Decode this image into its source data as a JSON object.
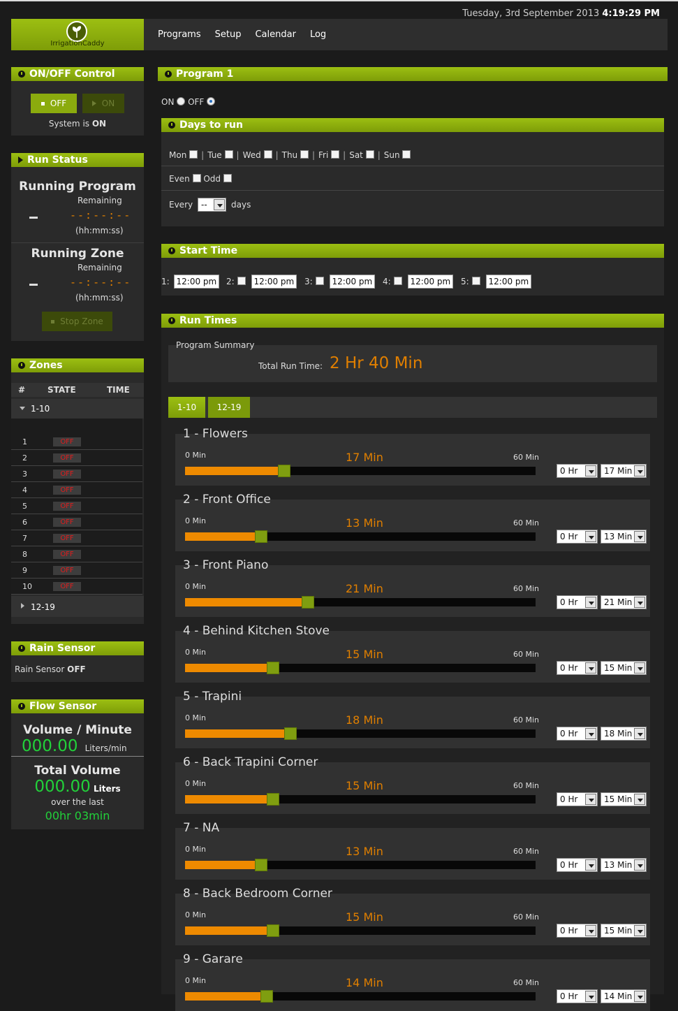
{
  "datetime": {
    "date": "Tuesday, 3rd September 2013",
    "time": "4:19:29 PM"
  },
  "logo": {
    "text": "IrrigationCaddy"
  },
  "nav": [
    "Programs",
    "Setup",
    "Calendar",
    "Log"
  ],
  "onoff": {
    "title": "ON/OFF Control",
    "off_label": "OFF",
    "on_label": "ON",
    "status_prefix": "System is",
    "status_value": "ON"
  },
  "run_status": {
    "title": "Run Status",
    "program_title": "Running Program",
    "zone_title": "Running Zone",
    "remaining": "Remaining",
    "time": "--:--:--",
    "unit": "(hh:mm:ss)",
    "stop_label": "Stop Zone"
  },
  "zones_panel": {
    "title": "Zones",
    "col_num": "#",
    "col_state": "STATE",
    "col_time": "TIME",
    "group1": "1-10",
    "group2": "12-19",
    "rows": [
      {
        "num": "1",
        "state": "OFF"
      },
      {
        "num": "2",
        "state": "OFF"
      },
      {
        "num": "3",
        "state": "OFF"
      },
      {
        "num": "4",
        "state": "OFF"
      },
      {
        "num": "5",
        "state": "OFF"
      },
      {
        "num": "6",
        "state": "OFF"
      },
      {
        "num": "7",
        "state": "OFF"
      },
      {
        "num": "8",
        "state": "OFF"
      },
      {
        "num": "9",
        "state": "OFF"
      },
      {
        "num": "10",
        "state": "OFF"
      }
    ]
  },
  "rain": {
    "title": "Rain Sensor",
    "label": "Rain Sensor",
    "value": "OFF"
  },
  "flow": {
    "title": "Flow Sensor",
    "vpm_title": "Volume / Minute",
    "vpm_value": "000.00",
    "vpm_unit": "Liters/min",
    "total_title": "Total Volume",
    "total_value": "000.00",
    "total_unit": "Liters",
    "over_last": "over the last",
    "duration": "00hr 03min"
  },
  "program": {
    "title": "Program 1",
    "on_label": "ON",
    "off_label": "OFF",
    "days_title": "Days to run",
    "days": [
      "Mon",
      "Tue",
      "Wed",
      "Thu",
      "Fri",
      "Sat",
      "Sun"
    ],
    "even": "Even",
    "odd": "Odd",
    "every": "Every",
    "every_value": "--",
    "days_suffix": "days",
    "start_title": "Start Time",
    "starts": [
      {
        "label": "1:",
        "value": "12:00 pm"
      },
      {
        "label": "2:",
        "value": "12:00 pm"
      },
      {
        "label": "3:",
        "value": "12:00 pm"
      },
      {
        "label": "4:",
        "value": "12:00 pm"
      },
      {
        "label": "5:",
        "value": "12:00 pm"
      }
    ],
    "run_title": "Run Times",
    "summary_title": "Program Summary",
    "total_label": "Total Run Time:",
    "total_value": "2 Hr 40 Min",
    "tabs": [
      "1-10",
      "12-19"
    ],
    "min_label": "0 Min",
    "max_label": "60 Min",
    "zones": [
      {
        "name": "1 - Flowers",
        "minutes": 17,
        "value": "17 Min",
        "hr": "0 Hr",
        "min_sel": "17 Min"
      },
      {
        "name": "2 - Front Office",
        "minutes": 13,
        "value": "13 Min",
        "hr": "0 Hr",
        "min_sel": "13 Min"
      },
      {
        "name": "3 - Front Piano",
        "minutes": 21,
        "value": "21 Min",
        "hr": "0 Hr",
        "min_sel": "21 Min"
      },
      {
        "name": "4 - Behind Kitchen Stove",
        "minutes": 15,
        "value": "15 Min",
        "hr": "0 Hr",
        "min_sel": "15 Min"
      },
      {
        "name": "5 - Trapini",
        "minutes": 18,
        "value": "18 Min",
        "hr": "0 Hr",
        "min_sel": "18 Min"
      },
      {
        "name": "6 - Back Trapini Corner",
        "minutes": 15,
        "value": "15 Min",
        "hr": "0 Hr",
        "min_sel": "15 Min"
      },
      {
        "name": "7 - NA",
        "minutes": 13,
        "value": "13 Min",
        "hr": "0 Hr",
        "min_sel": "13 Min"
      },
      {
        "name": "8 - Back Bedroom Corner",
        "minutes": 15,
        "value": "15 Min",
        "hr": "0 Hr",
        "min_sel": "15 Min"
      },
      {
        "name": "9 - Garare",
        "minutes": 14,
        "value": "14 Min",
        "hr": "0 Hr",
        "min_sel": "14 Min"
      }
    ]
  }
}
